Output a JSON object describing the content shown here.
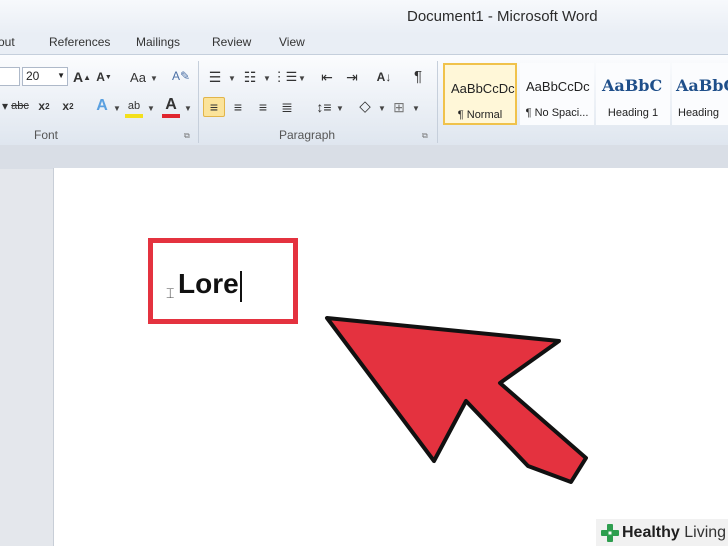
{
  "window": {
    "title": "Document1  -  Microsoft Word"
  },
  "tabs": [
    {
      "label": "out"
    },
    {
      "label": "References"
    },
    {
      "label": "Mailings"
    },
    {
      "label": "Review"
    },
    {
      "label": "View"
    }
  ],
  "font_group": {
    "size_value": "20",
    "label": "Font"
  },
  "paragraph_group": {
    "label": "Paragraph"
  },
  "styles": [
    {
      "sample": "AaBbCcDc",
      "name": "¶ Normal"
    },
    {
      "sample": "AaBbCcDc",
      "name": "¶ No Spaci..."
    },
    {
      "sample": "AaBbC",
      "name": "Heading 1"
    },
    {
      "sample": "AaBbC",
      "name": "Heading"
    }
  ],
  "document": {
    "text": "Lore"
  },
  "highlight_color": "#e4323f",
  "arrow_color": "#e4323f",
  "watermark": {
    "brand": "Healthy",
    "suffix": " Living",
    "icon": "plus-cross-icon",
    "icon_color": "#2e9e4f"
  }
}
